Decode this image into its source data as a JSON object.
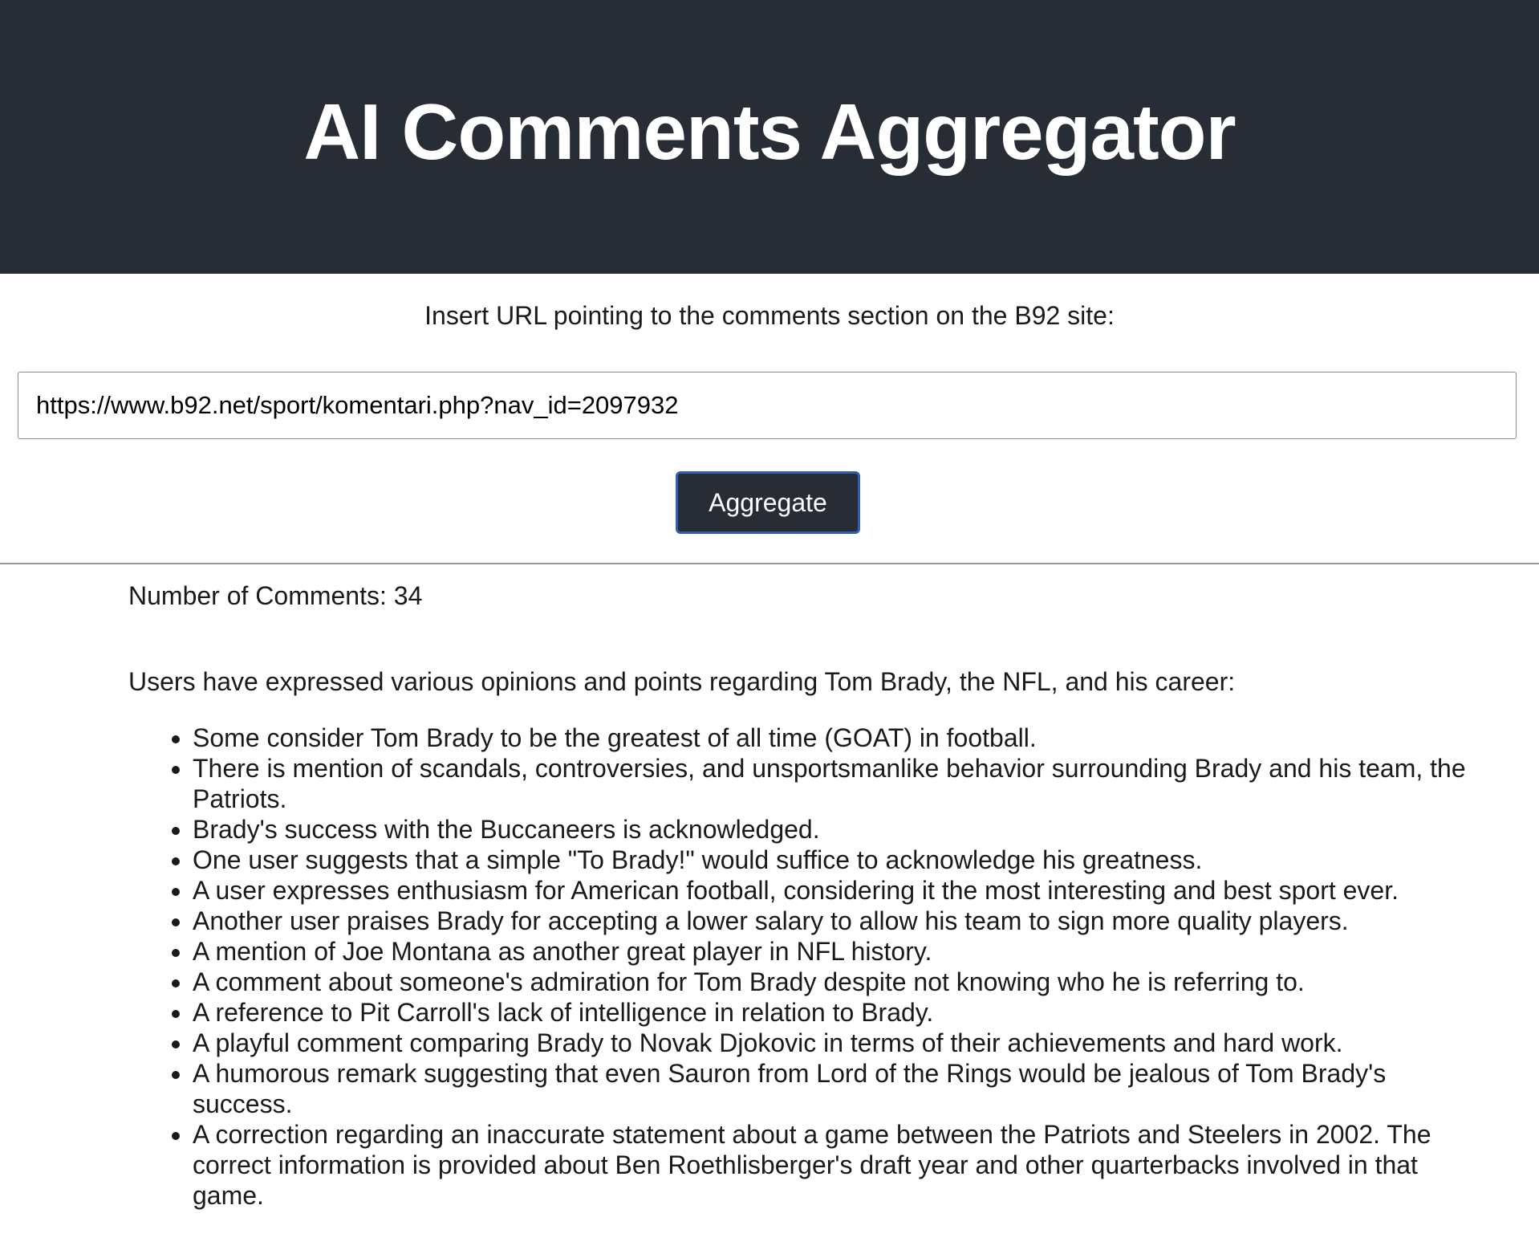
{
  "header": {
    "title": "AI Comments Aggregator"
  },
  "form": {
    "prompt_label": "Insert URL pointing to the comments section on the B92 site:",
    "url_value": "https://www.b92.net/sport/komentari.php?nav_id=2097932",
    "button_label": "Aggregate"
  },
  "results": {
    "comment_count_text": "Number of Comments: 34",
    "summary_intro": "Users have expressed various opinions and points regarding Tom Brady, the NFL, and his career:",
    "points": [
      "Some consider Tom Brady to be the greatest of all time (GOAT) in football.",
      "There is mention of scandals, controversies, and unsportsmanlike behavior surrounding Brady and his team, the Patriots.",
      "Brady's success with the Buccaneers is acknowledged.",
      "One user suggests that a simple \"To Brady!\" would suffice to acknowledge his greatness.",
      "A user expresses enthusiasm for American football, considering it the most interesting and best sport ever.",
      "Another user praises Brady for accepting a lower salary to allow his team to sign more quality players.",
      "A mention of Joe Montana as another great player in NFL history.",
      "A comment about someone's admiration for Tom Brady despite not knowing who he is referring to.",
      "A reference to Pit Carroll's lack of intelligence in relation to Brady.",
      "A playful comment comparing Brady to Novak Djokovic in terms of their achievements and hard work.",
      "A humorous remark suggesting that even Sauron from Lord of the Rings would be jealous of Tom Brady's success.",
      "A correction regarding an inaccurate statement about a game between the Patriots and Steelers in 2002. The correct information is provided about Ben Roethlisberger's draft year and other quarterbacks involved in that game."
    ]
  },
  "colors": {
    "header_bg": "#282c34",
    "button_border": "#2f5fb0"
  }
}
